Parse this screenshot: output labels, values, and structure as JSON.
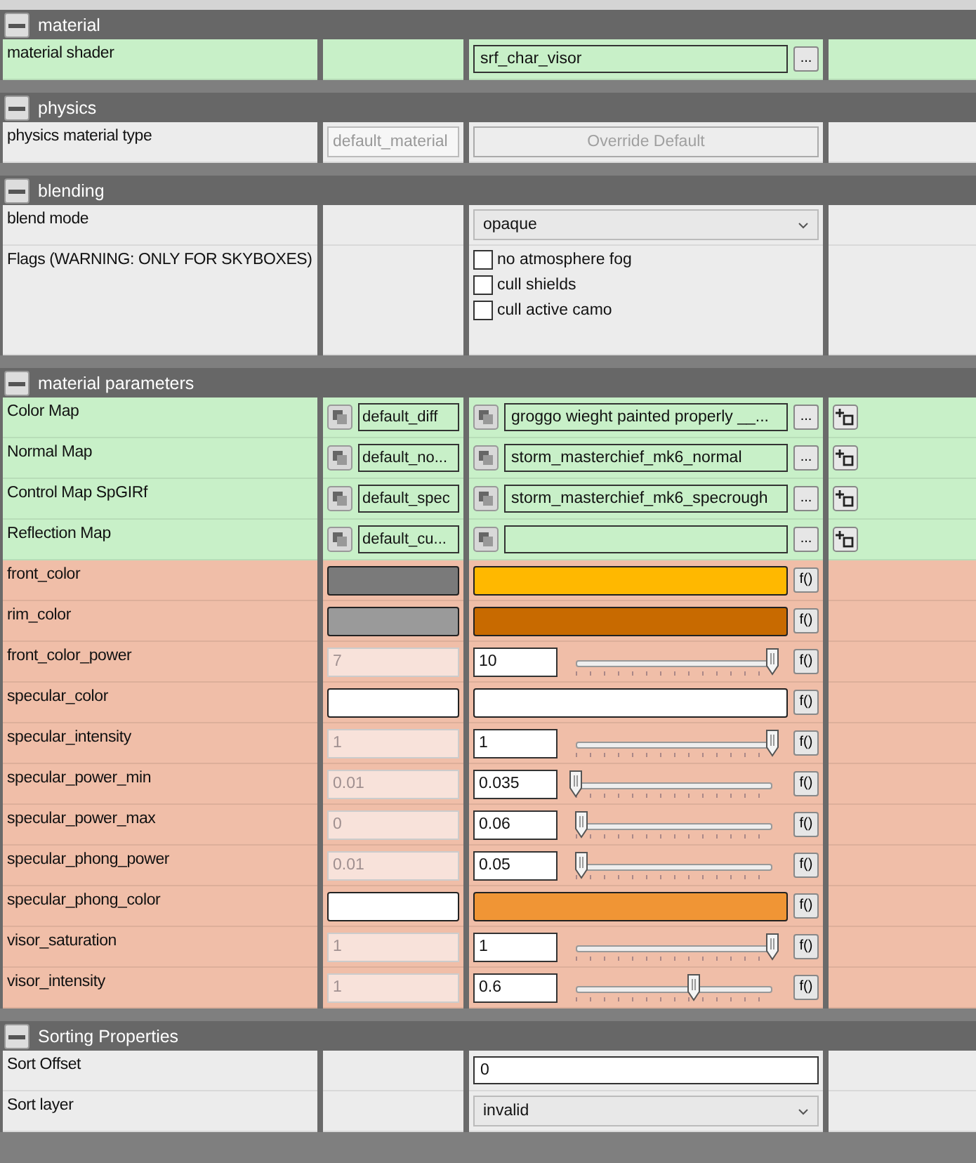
{
  "sections": [
    {
      "title": "material",
      "expanded": true,
      "rows": [
        {
          "kind": "shader",
          "label": "material shader",
          "value": "srf_char_visor",
          "browse": "..."
        }
      ]
    },
    {
      "title": "physics",
      "expanded": true,
      "rows": [
        {
          "kind": "override",
          "label": "physics material type",
          "default": "default_material",
          "button": "Override Default",
          "disabled": true
        }
      ]
    },
    {
      "title": "blending",
      "expanded": true,
      "rows": [
        {
          "kind": "dropdown",
          "label": "blend mode",
          "value": "opaque"
        },
        {
          "kind": "flags",
          "label": "Flags (WARNING: ONLY FOR SKYBOXES)",
          "flags": [
            {
              "label": "no atmosphere fog",
              "checked": false
            },
            {
              "label": "cull shields",
              "checked": false
            },
            {
              "label": "cull active camo",
              "checked": false
            }
          ]
        }
      ]
    },
    {
      "title": "material parameters",
      "expanded": true,
      "rows": [
        {
          "kind": "bitmap",
          "label": "Color Map",
          "default": "default_diff",
          "value": "groggo wieght painted properly __...",
          "browse": "..."
        },
        {
          "kind": "bitmap",
          "label": "Normal Map",
          "default": "default_no...",
          "value": "storm_masterchief_mk6_normal",
          "browse": "..."
        },
        {
          "kind": "bitmap",
          "label": "Control Map SpGIRf",
          "default": "default_spec",
          "value": "storm_masterchief_mk6_specrough",
          "browse": "..."
        },
        {
          "kind": "bitmap",
          "label": "Reflection Map",
          "default": "default_cu...",
          "value": "",
          "browse": "..."
        },
        {
          "kind": "color",
          "label": "front_color",
          "default_swatch": {
            "color": "#7a7a7a"
          },
          "value_swatch": {
            "color": "#ffb800"
          },
          "function": "f()"
        },
        {
          "kind": "color",
          "label": "rim_color",
          "default_swatch": {
            "color": "#9a9a9a"
          },
          "value_swatch": {
            "color": "#c86a00"
          },
          "function": "f()"
        },
        {
          "kind": "real",
          "label": "front_color_power",
          "default": "7",
          "value": "10",
          "level": 1,
          "function": "f()"
        },
        {
          "kind": "color",
          "label": "specular_color",
          "default_swatch": {
            "color": "#ffffff"
          },
          "value_swatch": {
            "color": "#ffffff"
          },
          "function": "f()"
        },
        {
          "kind": "real",
          "label": "specular_intensity",
          "default": "1",
          "value": "1",
          "level": 1,
          "function": "f()"
        },
        {
          "kind": "real",
          "label": "specular_power_min",
          "default": "0.01",
          "value": "0.035",
          "level": 0,
          "function": "f()"
        },
        {
          "kind": "real",
          "label": "specular_power_max",
          "default": "0",
          "value": "0.06",
          "level": 0.03,
          "function": "f()"
        },
        {
          "kind": "real",
          "label": "specular_phong_power",
          "default": "0.01",
          "value": "0.05",
          "level": 0.03,
          "function": "f()"
        },
        {
          "kind": "color",
          "label": "specular_phong_color",
          "default_swatch": {
            "color": "#ffffff"
          },
          "value_swatch": {
            "color": "#f09535"
          },
          "function": "f()"
        },
        {
          "kind": "real",
          "label": "visor_saturation",
          "default": "1",
          "value": "1",
          "level": 1,
          "function": "f()"
        },
        {
          "kind": "real",
          "label": "visor_intensity",
          "default": "1",
          "value": "0.6",
          "level": 0.6,
          "function": "f()"
        }
      ]
    },
    {
      "title": "Sorting Properties",
      "expanded": true,
      "rows": [
        {
          "kind": "text",
          "label": "Sort Offset",
          "value": "0"
        },
        {
          "kind": "dropdown",
          "label": "Sort layer",
          "value": "invalid"
        }
      ]
    }
  ]
}
